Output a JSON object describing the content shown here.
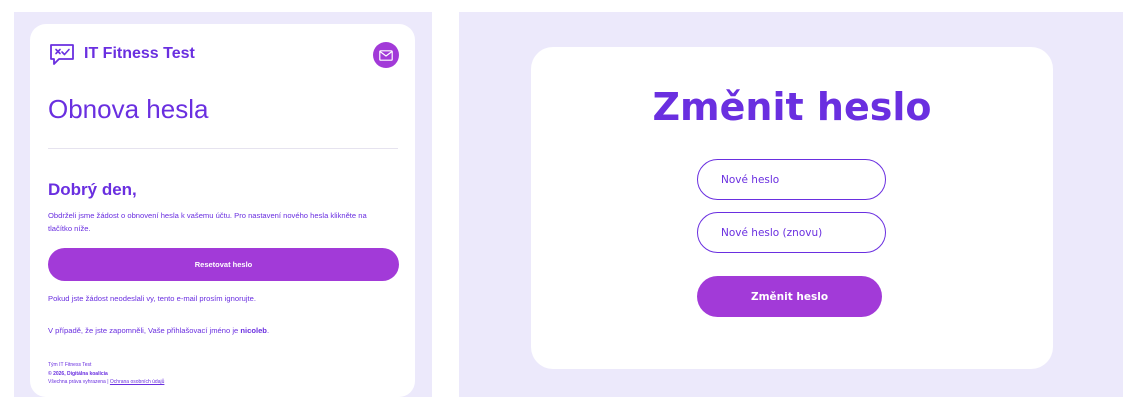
{
  "email": {
    "brand_name": "IT Fitness Test",
    "title": "Obnova hesla",
    "greeting": "Dobrý den,",
    "body": "Obdrželi jsme žádost o obnovení hesla k vašemu účtu. Pro nastavení nového hesla klikněte na tlačítko níže.",
    "reset_button": "Resetovat heslo",
    "ignore_text": "Pokud jste žádost neodeslali vy, tento e-mail prosím ignorujte.",
    "username_prefix": "V případě, že jste zapomněli, Vaše přihlašovací jméno je",
    "username": "nicoleb",
    "username_suffix": ".",
    "footer_team": "Tým IT Fitness Test",
    "footer_copyright": "© 2026, Digitálna koalícia",
    "footer_rights": "Všechna práva vyhrazena |",
    "footer_privacy_link": "Ochrana osobních údajů",
    "icons": {
      "logo": "chat-check-logo-icon",
      "mail": "envelope-icon"
    }
  },
  "form": {
    "title": "Změnit heslo",
    "new_password_placeholder": "Nové heslo",
    "confirm_password_placeholder": "Nové heslo (znovu)",
    "submit_button": "Změnit heslo"
  },
  "colors": {
    "primary_text": "#6a2fe0",
    "button": "#a23ad8",
    "panel_background": "#ece9fb",
    "card_background": "#ffffff"
  }
}
